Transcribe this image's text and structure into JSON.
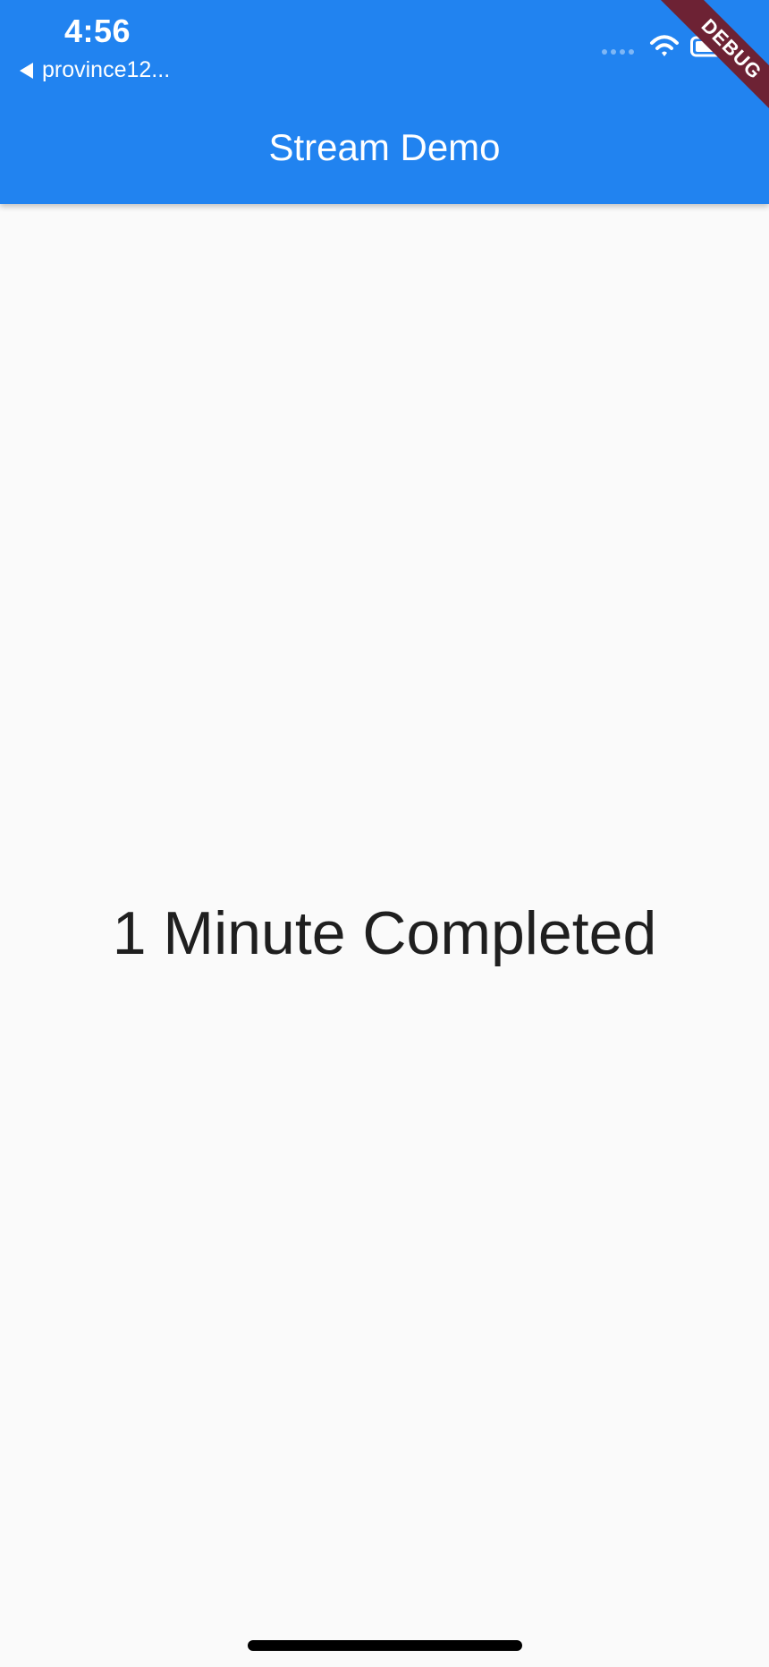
{
  "status_bar": {
    "time": "4:56",
    "back_app": "province12...",
    "signal_icon": "signal-dots-icon",
    "wifi_icon": "wifi-icon",
    "battery_icon": "battery-icon"
  },
  "debug_banner": {
    "label": "DEBUG"
  },
  "app_bar": {
    "title": "Stream Demo",
    "background_color": "#2183f0"
  },
  "main": {
    "message": "1 Minute Completed",
    "background_color": "#fafafa",
    "text_color": "#1f1f1f"
  },
  "home_indicator": {
    "icon": "home-indicator-icon",
    "color": "#000000"
  }
}
